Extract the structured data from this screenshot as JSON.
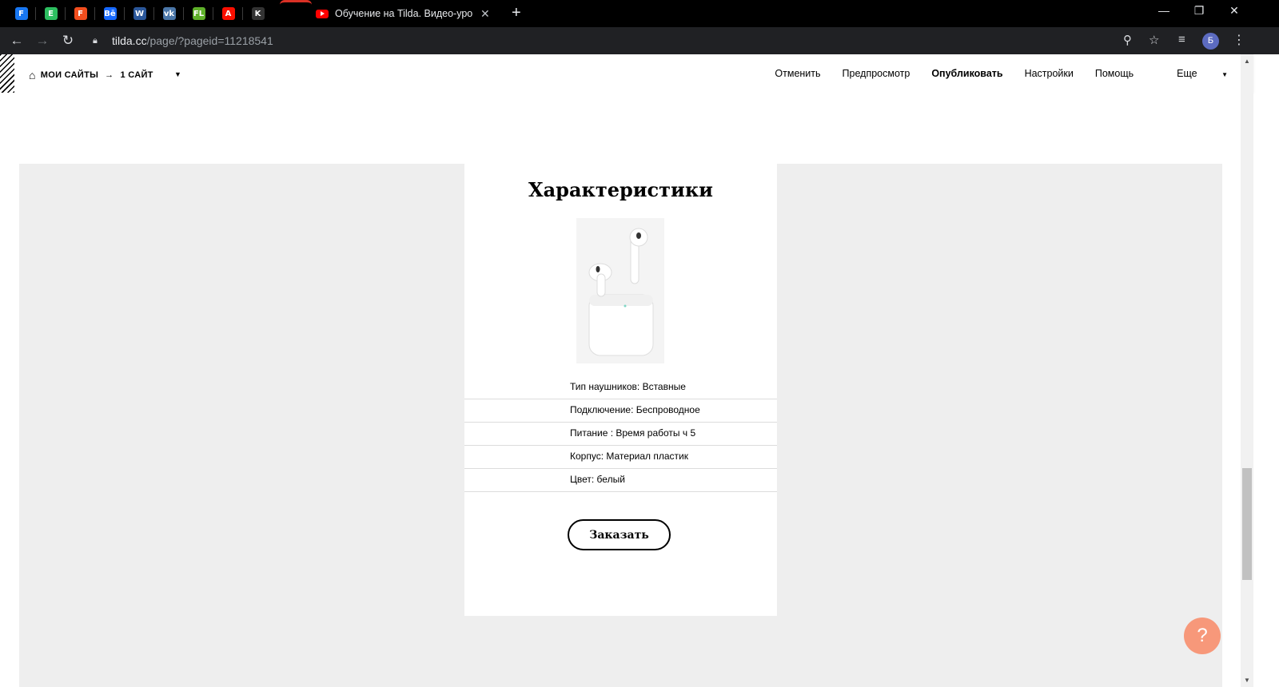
{
  "browser": {
    "pinned_tabs": [
      {
        "icon": "facebook-icon",
        "letter": "F",
        "color": "#1877f2"
      },
      {
        "icon": "evernote-icon",
        "letter": "E",
        "color": "#2dbe60"
      },
      {
        "icon": "figma-icon",
        "letter": "F",
        "color": "#f24e1e"
      },
      {
        "icon": "behance-icon",
        "letter": "Bē",
        "color": "#1769ff"
      },
      {
        "icon": "word-icon",
        "letter": "W",
        "color": "#2b579a"
      },
      {
        "icon": "vk-icon",
        "letter": "vk",
        "color": "#4a76a8"
      },
      {
        "icon": "fl-icon",
        "letter": "FL",
        "color": "#5fb12a"
      },
      {
        "icon": "adobe-icon",
        "letter": "A",
        "color": "#fa0f00"
      },
      {
        "icon": "kwork-icon",
        "letter": "K",
        "color": "#333333"
      }
    ],
    "active_tab_title": "Обучение на Tilda. Видео-урок",
    "url_domain": "tilda.cc",
    "url_path": "/page/?pageid=11218541",
    "profile_initial": "Б"
  },
  "editor": {
    "breadcrumb_sites": "МОИ САЙТЫ",
    "breadcrumb_arrow": "→",
    "breadcrumb_site": "1 САЙТ",
    "menu": {
      "cancel": "Отменить",
      "preview": "Предпросмотр",
      "publish": "Опубликовать",
      "settings": "Настройки",
      "help": "Помощь",
      "more": "Еще"
    }
  },
  "card": {
    "title": "Характеристики",
    "specs": [
      "Тип наушников: Вставные",
      "Подключение: Беспроводное",
      "Питание : Время работы ч 5",
      "Корпус: Материал пластик",
      "Цвет: белый"
    ],
    "order_button": "Заказать"
  },
  "help_button_label": "?"
}
